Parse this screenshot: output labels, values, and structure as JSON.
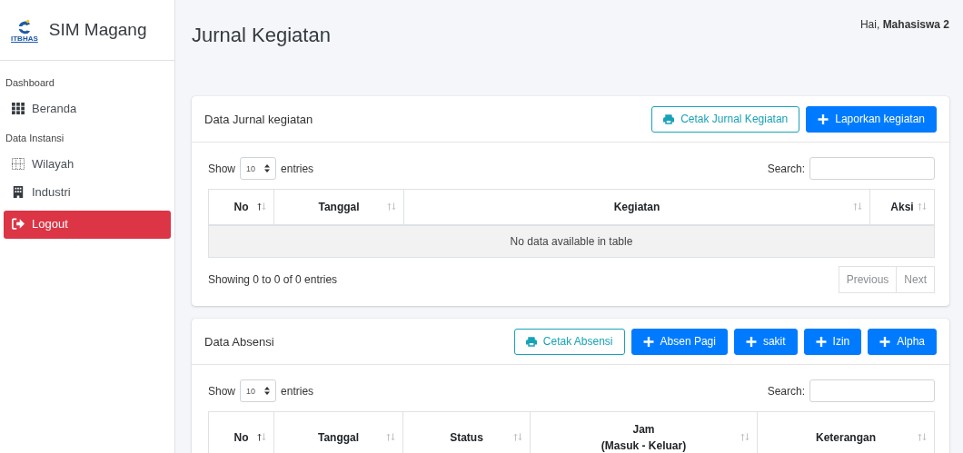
{
  "brand": {
    "logo_text": "ITBHAS",
    "title": "SIM Magang"
  },
  "sidebar": {
    "items": [
      {
        "kind": "header",
        "label": "Dashboard"
      },
      {
        "kind": "link",
        "label": "Beranda"
      },
      {
        "kind": "header",
        "label": "Data Instansi"
      },
      {
        "kind": "link",
        "label": "Wilayah"
      },
      {
        "kind": "link",
        "label": "Industri"
      },
      {
        "kind": "danger",
        "label": "Logout"
      }
    ]
  },
  "topbar": {
    "greeting": "Hai, **Mahasiswa 2**"
  },
  "page_title": "Jurnal Kegiatan",
  "cards": [
    {
      "title": "Data Jurnal kegiatan",
      "buttons": [
        {
          "kind": "outline",
          "label": "Cetak Jurnal Kegiatan"
        },
        {
          "kind": "primary",
          "label": "Laporkan kegiatan"
        }
      ],
      "length": {
        "before": "Show",
        "value": "10",
        "after": "entries"
      },
      "search_label": "Search:",
      "columns": [
        {
          "label": "No",
          "sorted": true
        },
        {
          "label": "Tanggal",
          "sorted": false
        },
        {
          "label": "Kegiatan",
          "sorted": false
        },
        {
          "label": "Aksi",
          "sorted": false
        }
      ],
      "empty_message": "No data available in table",
      "info": "Showing 0 to 0 of 0 entries",
      "pagination": [
        {
          "label": "Previous",
          "disabled": true
        },
        {
          "label": "Next",
          "disabled": true
        }
      ]
    },
    {
      "title": "Data Absensi",
      "buttons": [
        {
          "kind": "outline",
          "label": "Cetak Absensi"
        },
        {
          "kind": "primary",
          "label": "Absen Pagi"
        },
        {
          "kind": "primary",
          "label": "sakit"
        },
        {
          "kind": "primary",
          "label": "Izin"
        },
        {
          "kind": "primary",
          "label": "Alpha"
        }
      ],
      "length": {
        "before": "Show",
        "value": "10",
        "after": "entries"
      },
      "search_label": "Search:",
      "columns": [
        {
          "label": "No",
          "sorted": true
        },
        {
          "label": "Tanggal",
          "sorted": false
        },
        {
          "label": "Status",
          "sorted": false
        },
        {
          "label": "Jam\n(Masuk - Keluar)",
          "sorted": false
        },
        {
          "label": "Keterangan",
          "sorted": false
        }
      ]
    }
  ]
}
